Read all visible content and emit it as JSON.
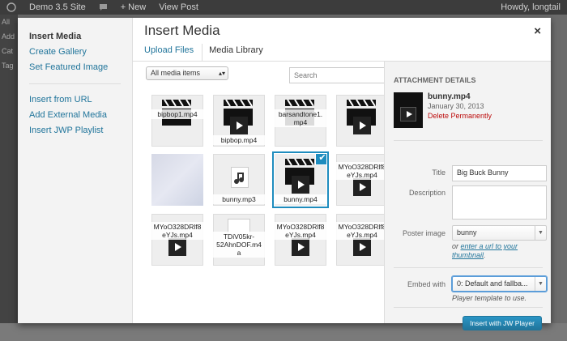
{
  "adminbar": {
    "site": "Demo 3.5 Site",
    "new_label": "+ New",
    "view_post": "View Post",
    "howdy": "Howdy, longtail"
  },
  "backdrop": {
    "side_labels": [
      "All",
      "Add",
      "Cat",
      "Tag"
    ]
  },
  "modal": {
    "title": "Insert Media",
    "close": "×",
    "menu": {
      "group1": [
        "Insert Media",
        "Create Gallery",
        "Set Featured Image"
      ],
      "group2": [
        "Insert from URL",
        "Add External Media",
        "Insert JWP Playlist"
      ]
    },
    "tabs": [
      "Upload Files",
      "Media Library"
    ],
    "filter": {
      "selected": "All media items"
    },
    "search": {
      "placeholder": "Search"
    },
    "items": [
      {
        "name": "bipbop1.mp4",
        "type": "video"
      },
      {
        "name": "bipbop.mp4",
        "type": "video"
      },
      {
        "name": "barsandtone1.mp4",
        "type": "video"
      },
      {
        "name": "",
        "type": "video"
      },
      {
        "name": "",
        "type": "image"
      },
      {
        "name": "bunny.mp3",
        "type": "audio"
      },
      {
        "name": "bunny.mp4",
        "type": "video",
        "selected": true
      },
      {
        "name": "MYoO328DRlf8eYJs.mp4",
        "type": "video"
      },
      {
        "name": "MYoO328DRlf8eYJs.mp4",
        "type": "video"
      },
      {
        "name": "TDiV05kr-52AhnDOF.m4a",
        "type": "audio"
      },
      {
        "name": "MYoO328DRlf8eYJs.mp4",
        "type": "video"
      },
      {
        "name": "MYoO328DRlf8eYJs.mp4",
        "type": "video"
      }
    ],
    "details": {
      "heading": "ATTACHMENT DETAILS",
      "filename": "bunny.mp4",
      "date": "January 30, 2013",
      "delete": "Delete Permanently",
      "title_label": "Title",
      "title_value": "Big Buck Bunny",
      "description_label": "Description",
      "description_value": "",
      "poster_label": "Poster image",
      "poster_value": "bunny",
      "poster_hint_pre": "or ",
      "poster_hint_link": "enter a url to your thumbnail",
      "poster_hint_post": ".",
      "embed_label": "Embed with",
      "embed_value": "0: Default and fallba...",
      "embed_hint": "Player template to use.",
      "insert_button": "Insert with JW Player"
    }
  }
}
